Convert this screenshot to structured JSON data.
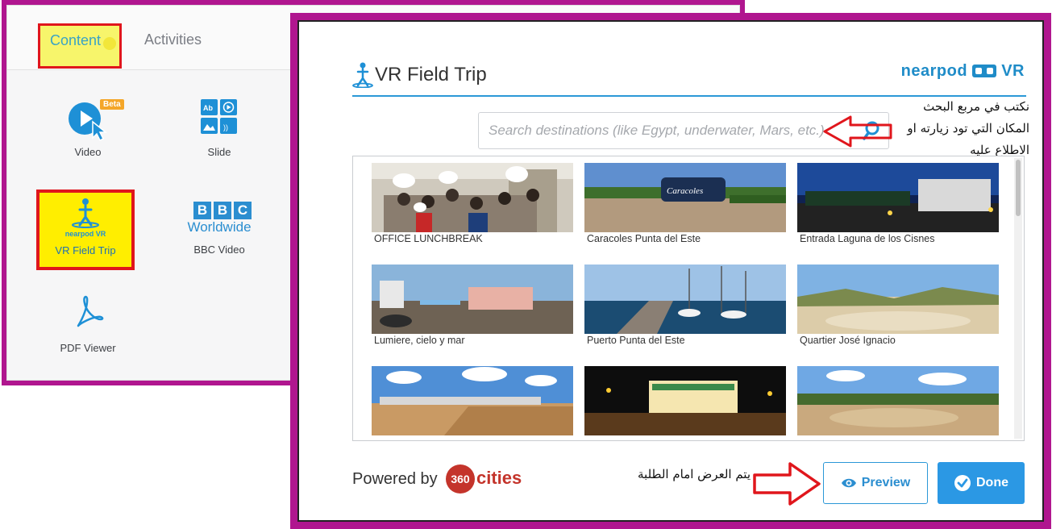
{
  "left_panel": {
    "tabs": {
      "content": "Content",
      "activities": "Activities"
    },
    "tiles": [
      {
        "label": "Video",
        "badge": "Beta",
        "icon": "video-cursor-icon"
      },
      {
        "label": "Slide",
        "icon": "slide-icon"
      },
      {
        "label": "VR Field Trip",
        "logo": "nearpod",
        "logo_suffix": "VR",
        "icon": "vr-person-icon"
      },
      {
        "label": "BBC Video",
        "bbc_letters": [
          "B",
          "B",
          "C"
        ],
        "worldwide": "Worldwide",
        "icon": "bbc-logo"
      },
      {
        "label": "PDF Viewer",
        "icon": "pdf-icon"
      }
    ]
  },
  "modal": {
    "title": "VR Field Trip",
    "brand": "nearpod",
    "brand_suffix": "VR",
    "search": {
      "placeholder": "Search destinations (like Egypt, underwater, Mars, etc.)"
    },
    "arabic_note_search": "نكتب في مربع البحث المكان التي تود زيارته او الاطلاع عليه",
    "results": [
      {
        "caption": "OFFICE LUNCHBREAK"
      },
      {
        "caption": "Caracoles Punta del Este"
      },
      {
        "caption": "Entrada Laguna de los Cisnes"
      },
      {
        "caption": "Lumiere, cielo y mar"
      },
      {
        "caption": "Puerto Punta del Este"
      },
      {
        "caption": "Quartier José Ignacio"
      },
      {
        "caption": ""
      },
      {
        "caption": ""
      },
      {
        "caption": ""
      }
    ],
    "thumb_sign_text": "Caracoles",
    "powered_by": "Powered by",
    "powered_logo_num": "360",
    "powered_logo_word": "cities",
    "arabic_note_preview": "يتم العرض امام الطلبة",
    "buttons": {
      "preview": "Preview",
      "done": "Done"
    }
  },
  "colors": {
    "frame": "#b0168f",
    "accent": "#2b98d7",
    "highlight_red": "#e0161c",
    "highlight_yellow": "#ffee00",
    "arrow_red": "#e0161c"
  }
}
